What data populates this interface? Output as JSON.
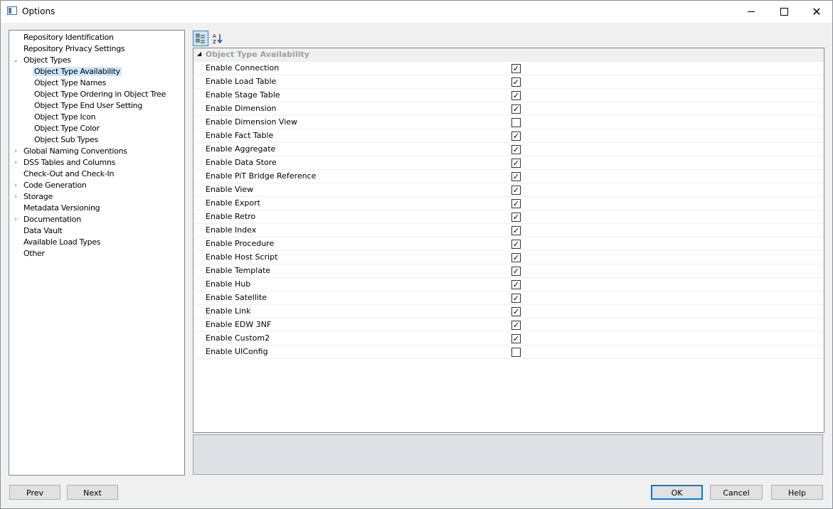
{
  "window": {
    "title": "Options",
    "minimize": "minimize",
    "maximize": "maximize",
    "close": "✕"
  },
  "tree": {
    "items": [
      {
        "label": "Repository Identification",
        "level": 0,
        "expander": ""
      },
      {
        "label": "Repository Privacy Settings",
        "level": 0,
        "expander": ""
      },
      {
        "label": "Object Types",
        "level": 0,
        "expander": "expanded"
      },
      {
        "label": "Object Type Availability",
        "level": 1,
        "expander": "",
        "selected": true
      },
      {
        "label": "Object Type Names",
        "level": 1,
        "expander": ""
      },
      {
        "label": "Object Type Ordering in Object Tree",
        "level": 1,
        "expander": ""
      },
      {
        "label": "Object Type End User Setting",
        "level": 1,
        "expander": ""
      },
      {
        "label": "Object Type Icon",
        "level": 1,
        "expander": ""
      },
      {
        "label": "Object Type Color",
        "level": 1,
        "expander": ""
      },
      {
        "label": "Object Sub Types",
        "level": 1,
        "expander": ""
      },
      {
        "label": "Global Naming Conventions",
        "level": 0,
        "expander": "collapsed"
      },
      {
        "label": "DSS Tables and Columns",
        "level": 0,
        "expander": "collapsed"
      },
      {
        "label": "Check-Out and Check-In",
        "level": 0,
        "expander": ""
      },
      {
        "label": "Code Generation",
        "level": 0,
        "expander": "collapsed"
      },
      {
        "label": "Storage",
        "level": 0,
        "expander": "collapsed"
      },
      {
        "label": "Metadata Versioning",
        "level": 0,
        "expander": ""
      },
      {
        "label": "Documentation",
        "level": 0,
        "expander": "collapsed"
      },
      {
        "label": "Data Vault",
        "level": 0,
        "expander": ""
      },
      {
        "label": "Available Load Types",
        "level": 0,
        "expander": ""
      },
      {
        "label": "Other",
        "level": 0,
        "expander": ""
      }
    ]
  },
  "toolbar": {
    "categorized_icon": "categorized-icon",
    "alphabetical_icon": "alphabetical-sort-icon"
  },
  "grid": {
    "category": "Object Type Availability",
    "properties": [
      {
        "name": "Enable Connection",
        "checked": true
      },
      {
        "name": "Enable Load Table",
        "checked": true
      },
      {
        "name": "Enable Stage Table",
        "checked": true
      },
      {
        "name": "Enable Dimension",
        "checked": true
      },
      {
        "name": "Enable Dimension View",
        "checked": false
      },
      {
        "name": "Enable Fact Table",
        "checked": true
      },
      {
        "name": "Enable Aggregate",
        "checked": true
      },
      {
        "name": "Enable Data Store",
        "checked": true
      },
      {
        "name": "Enable PiT Bridge Reference",
        "checked": true
      },
      {
        "name": "Enable View",
        "checked": true
      },
      {
        "name": "Enable Export",
        "checked": true
      },
      {
        "name": "Enable Retro",
        "checked": true
      },
      {
        "name": "Enable Index",
        "checked": true
      },
      {
        "name": "Enable Procedure",
        "checked": true
      },
      {
        "name": "Enable Host Script",
        "checked": true
      },
      {
        "name": "Enable Template",
        "checked": true
      },
      {
        "name": "Enable Hub",
        "checked": true
      },
      {
        "name": "Enable Satellite",
        "checked": true
      },
      {
        "name": "Enable Link",
        "checked": true
      },
      {
        "name": "Enable EDW 3NF",
        "checked": true
      },
      {
        "name": "Enable Custom2",
        "checked": true
      },
      {
        "name": "Enable UIConfig",
        "checked": false
      }
    ]
  },
  "buttons": {
    "prev": "Prev",
    "next": "Next",
    "ok": "OK",
    "cancel": "Cancel",
    "help": "Help"
  },
  "colors": {
    "selection": "#cce8ff",
    "accent": "#0078d7",
    "category_text": "#9a9ea6",
    "description_pane": "#dde1e6"
  }
}
